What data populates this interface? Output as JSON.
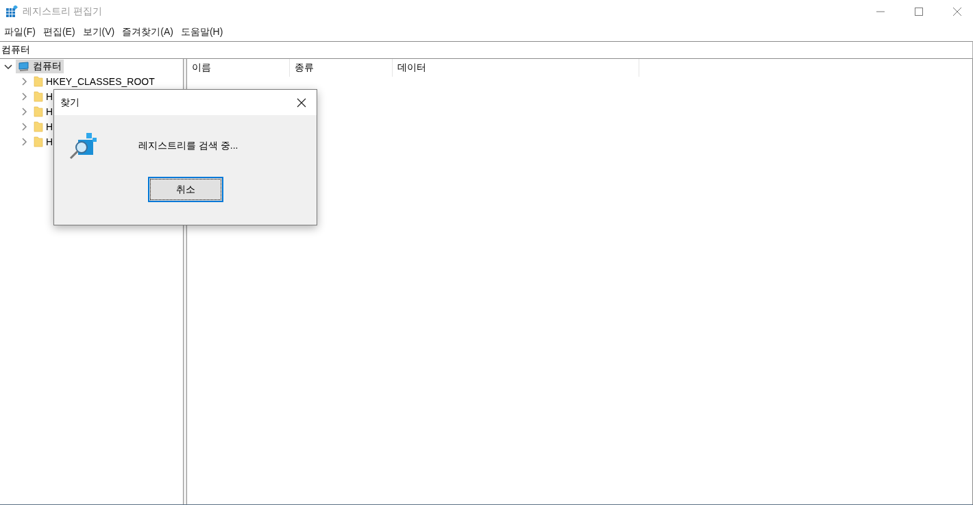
{
  "window": {
    "title": "레지스트리 편집기"
  },
  "menu": [
    "파일(F)",
    "편집(E)",
    "보기(V)",
    "즐겨찾기(A)",
    "도움말(H)"
  ],
  "address": "컴퓨터",
  "tree": [
    {
      "label": "컴퓨터",
      "kind": "computer",
      "selected": true,
      "expanded": true,
      "children": [
        {
          "label": "HKEY_CLASSES_ROOT",
          "kind": "folder",
          "selected": false,
          "expanded": false
        },
        {
          "label": "H",
          "kind": "folder",
          "selected": false,
          "expanded": false
        },
        {
          "label": "H",
          "kind": "folder",
          "selected": false,
          "expanded": false
        },
        {
          "label": "H",
          "kind": "folder",
          "selected": false,
          "expanded": false
        },
        {
          "label": "H",
          "kind": "folder",
          "selected": false,
          "expanded": false
        }
      ]
    }
  ],
  "columns": [
    "이름",
    "종류",
    "데이터"
  ],
  "dialog": {
    "title": "찾기",
    "message": "레지스트리를 검색 중...",
    "button": "취소"
  }
}
